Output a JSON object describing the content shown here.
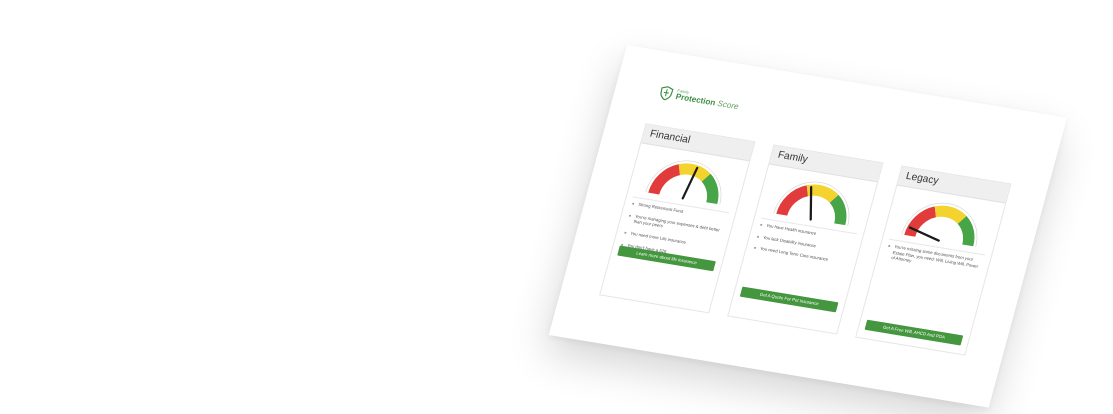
{
  "brand": {
    "line1": "Family",
    "line2_bold": "Protection",
    "line2_italic": " Score"
  },
  "colors": {
    "red": "#e23b3b",
    "yellow": "#f4d32e",
    "green": "#47a447",
    "needle": "#1a1a1a",
    "button": "#44963f"
  },
  "cards": [
    {
      "title": "Financial",
      "level": 0.56,
      "items": [
        "Strong Retirement Fund",
        "You're managing your expenses & debt better than your peers",
        "You need more Life insurance",
        "You don't have a 529"
      ],
      "cta": "Learn more about life insurance"
    },
    {
      "title": "Family",
      "level": 0.42,
      "items": [
        "You have Health insurance",
        "You lack Disability insurance",
        "You need Long Term Care insurance"
      ],
      "cta": "Get A Quote For Pet Insurance"
    },
    {
      "title": "Legacy",
      "level": 0.08,
      "items": [
        "You're missing some documents from your Estate Plan, you need: Will, Living Will, Power of Attorney"
      ],
      "cta": "Get A Free Will, AHCD And POA"
    }
  ]
}
